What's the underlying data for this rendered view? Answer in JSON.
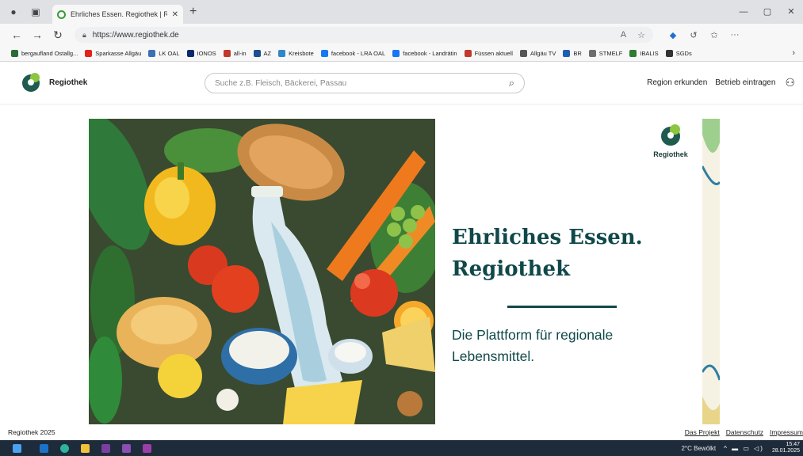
{
  "browser": {
    "tab_title": "Ehrliches Essen. Regiothek | Regio",
    "url": "https://www.regiothek.de",
    "bookmarks": [
      {
        "label": "bergaufland Ostallg...",
        "color": "#2a6b3a"
      },
      {
        "label": "Sparkasse Allgäu",
        "color": "#e2231a"
      },
      {
        "label": "LK OAL",
        "color": "#3b6fb6"
      },
      {
        "label": "IONOS",
        "color": "#0b2a6b"
      },
      {
        "label": "all-in",
        "color": "#c0392b"
      },
      {
        "label": "AZ",
        "color": "#1d4f91"
      },
      {
        "label": "Kreisbote",
        "color": "#2f86c9"
      },
      {
        "label": "facebook - LRA OAL",
        "color": "#1877f2"
      },
      {
        "label": "facebook - Landrätin",
        "color": "#1877f2"
      },
      {
        "label": "Füssen aktuell",
        "color": "#c0392b"
      },
      {
        "label": "Allgäu TV",
        "color": "#555555"
      },
      {
        "label": "BR",
        "color": "#1f5fb0"
      },
      {
        "label": "STMELF",
        "color": "#6d6d6d"
      },
      {
        "label": "IBALIS",
        "color": "#2e7d32"
      },
      {
        "label": "SGDs",
        "color": "#333333"
      }
    ],
    "bookmark_br_prefix": "BR"
  },
  "site": {
    "brand": "Regiothek",
    "search_placeholder": "Suche z.B. Fleisch, Bäckerei, Passau",
    "nav": {
      "explore": "Region erkunden",
      "register": "Betrieb eintragen"
    },
    "hero": {
      "badge": "Regiothek",
      "headline_line1": "Ehrliches Essen.",
      "headline_line2": "Regiothek",
      "tagline": "Die Plattform für regionale Lebensmittel."
    },
    "footer": {
      "copyright": "Regiothek 2025",
      "links": [
        "Das Projekt",
        "Datenschutz",
        "Impressum"
      ]
    }
  },
  "taskbar": {
    "weather": "2°C Bewölkt",
    "time": "15:47",
    "date": "28.01.2025"
  },
  "colors": {
    "brand_dark": "#10484a",
    "brand_green": "#8cc63f",
    "taskbar": "#1e2b3a"
  }
}
